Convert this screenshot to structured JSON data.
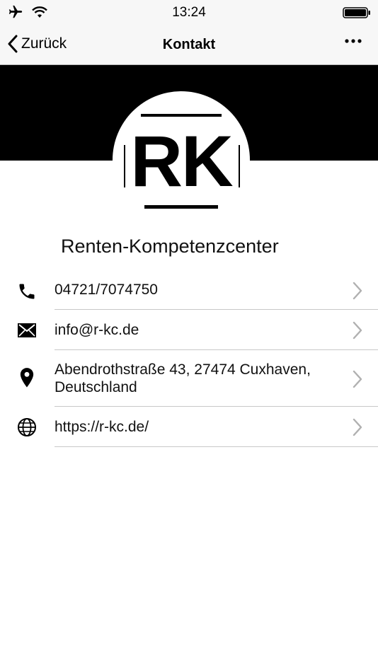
{
  "status": {
    "time": "13:24"
  },
  "nav": {
    "back_label": "Zurück",
    "title": "Kontakt"
  },
  "logo": {
    "text": "RK"
  },
  "company": "Renten-Kompetenzcenter",
  "contacts": [
    {
      "icon": "phone-icon",
      "text": "04721/7074750"
    },
    {
      "icon": "mail-icon",
      "text": "info@r-kc.de"
    },
    {
      "icon": "location-pin-icon",
      "line1": "Abendrothstraße 43, 27474 Cuxhaven,",
      "line2": "Deutschland"
    },
    {
      "icon": "globe-icon",
      "text": "https://r-kc.de/"
    }
  ],
  "colors": {
    "header": "#000000",
    "navbar": "#f7f7f7",
    "divider": "#c8c8c8",
    "chevron": "#b0b0b0"
  }
}
